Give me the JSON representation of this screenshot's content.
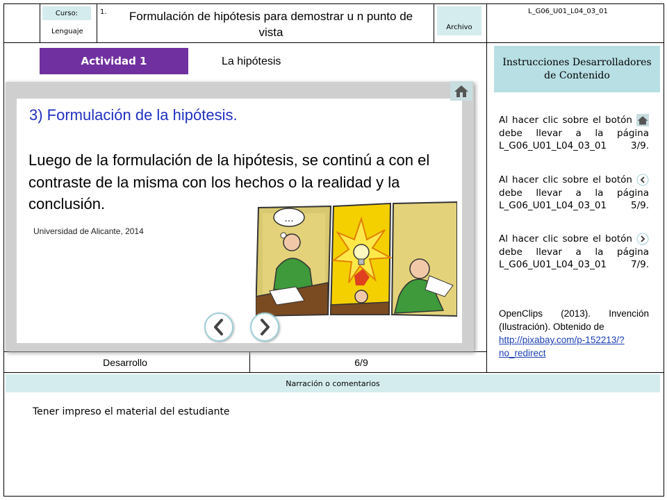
{
  "header": {
    "course_label": "Curso:",
    "subject": "Lenguaje",
    "number": "1.",
    "title": "Formulación de hipótesis para demostrar u n punto de vista",
    "file_label": "Archivo",
    "code": "L_G06_U01_L04_03_01"
  },
  "activity": {
    "label": "Actividad 1",
    "section": "La hipótesis"
  },
  "slide": {
    "heading": "3) Formulación de la hipótesis.",
    "body": "Luego de la formulación de la hipótesis, se continú a con el contraste de la misma con los hechos o la realidad y la conclusión.",
    "credit": "Universidad de Alicante, 2014",
    "thought_bubble": "..."
  },
  "instructions": {
    "title": "Instrucciones Desarrolladores de Contenido",
    "para1_pre": "Al hacer clic sobre el botón",
    "para1_post": "debe llevar a la página L_G06_U01_L04_03_01 3/9.",
    "para2_pre": "Al hacer clic sobre el botón",
    "para2_post": "debe llevar a la página L_G06_U01_L04_03_01 5/9.",
    "para3_pre": "Al hacer clic sobre el botón",
    "para3_post": "debe llevar a la página L_G06_U01_L04_03_01 7/9.",
    "reference": "OpenClips (2013). Invención (Ilustración). Obtenido de",
    "link": "http://pixabay.com/p-152213/?no_redirect"
  },
  "footer": {
    "stage": "Desarrollo",
    "page": "6/9"
  },
  "narration": {
    "label": "Narración o comentarios",
    "text": "Tener impreso el material del estudiante"
  },
  "colors": {
    "activity_bg": "#7030a0",
    "heading_blue": "#2030c0",
    "chip_bg": "#d4ecee",
    "instr_bg": "#b7dfe4"
  },
  "icons": {
    "home": "home-icon",
    "prev": "chevron-left-icon",
    "next": "chevron-right-icon"
  }
}
